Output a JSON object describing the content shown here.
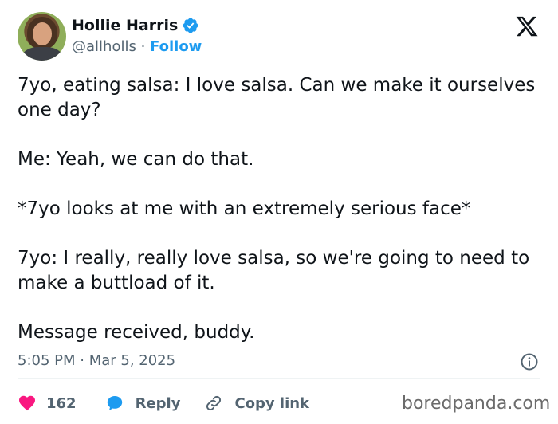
{
  "author": {
    "name": "Hollie Harris",
    "handle": "@allholls",
    "separator": "·",
    "follow_label": "Follow"
  },
  "tweet": {
    "lines": [
      "7yo, eating salsa: I love salsa. Can we make it ourselves one day?",
      "Me: Yeah, we can do that.",
      "*7yo looks at me with an extremely serious face*",
      "7yo: I really, really love salsa, so we're going to need to make a buttload of it.",
      "Message received, buddy."
    ],
    "timestamp": "5:05 PM · Mar 5, 2025"
  },
  "actions": {
    "like_count": "162",
    "reply_label": "Reply",
    "copy_link_label": "Copy link"
  },
  "watermark": "boredpanda.com",
  "colors": {
    "accent": "#1d9bf0",
    "like": "#f91880",
    "secondary_text": "#536471"
  },
  "icons": [
    "verified-badge-icon",
    "x-logo-icon",
    "info-icon",
    "heart-icon",
    "reply-bubble-icon",
    "link-icon"
  ]
}
